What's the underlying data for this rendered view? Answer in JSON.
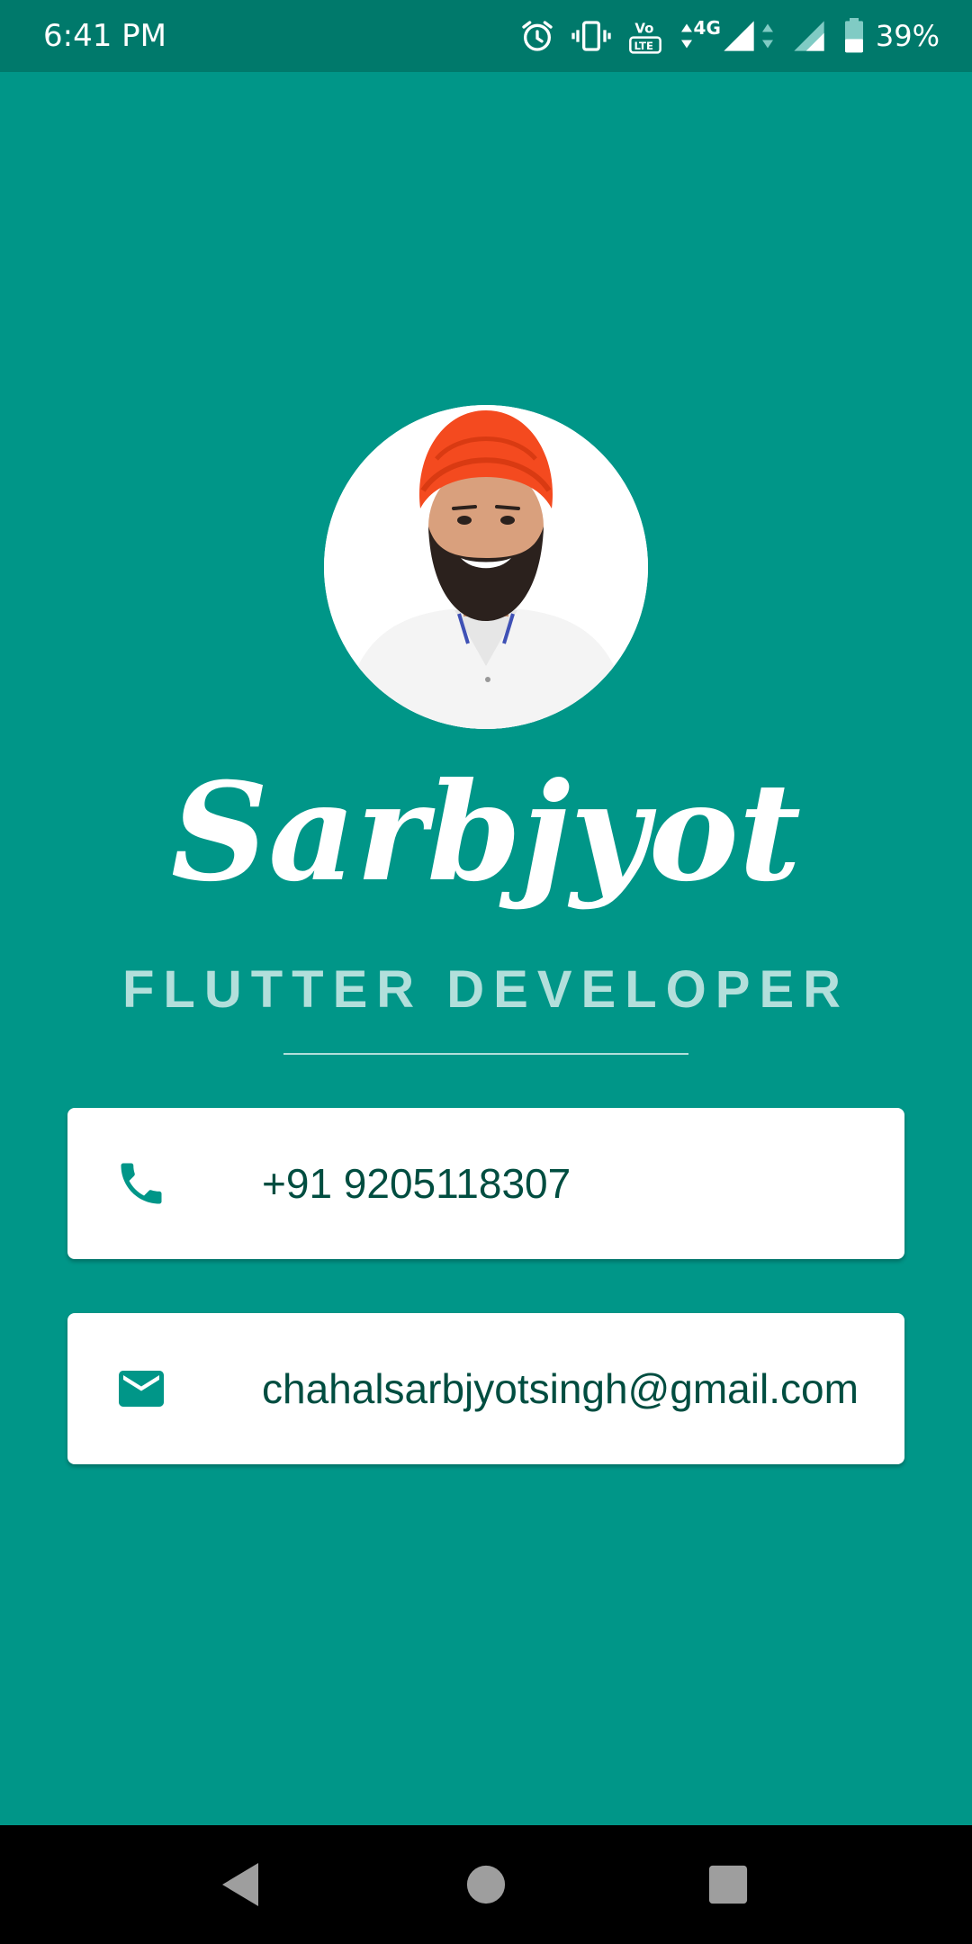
{
  "status_bar": {
    "time": "6:41 PM",
    "network": "4G",
    "battery": "39%",
    "icons": [
      "alarm-icon",
      "vibrate-icon",
      "volte-icon",
      "4g-data-icon",
      "signal-icon",
      "signal-icon",
      "battery-icon"
    ]
  },
  "profile": {
    "name": "Sarbjyot",
    "title": "FLUTTER DEVELOPER"
  },
  "contacts": {
    "phone": {
      "icon": "phone-icon",
      "value": "+91 9205118307"
    },
    "email": {
      "icon": "mail-icon",
      "value": "chahalsarbjyotsingh@gmail.com"
    }
  },
  "nav_bar": {
    "icons": [
      "back-icon",
      "home-icon",
      "recents-icon"
    ]
  },
  "colors": {
    "background": "#009688",
    "status_bar": "#00796b",
    "title": "#b2dfdb",
    "card_text": "#004d40",
    "icon": "#009688",
    "turban": "#f44a1f"
  }
}
